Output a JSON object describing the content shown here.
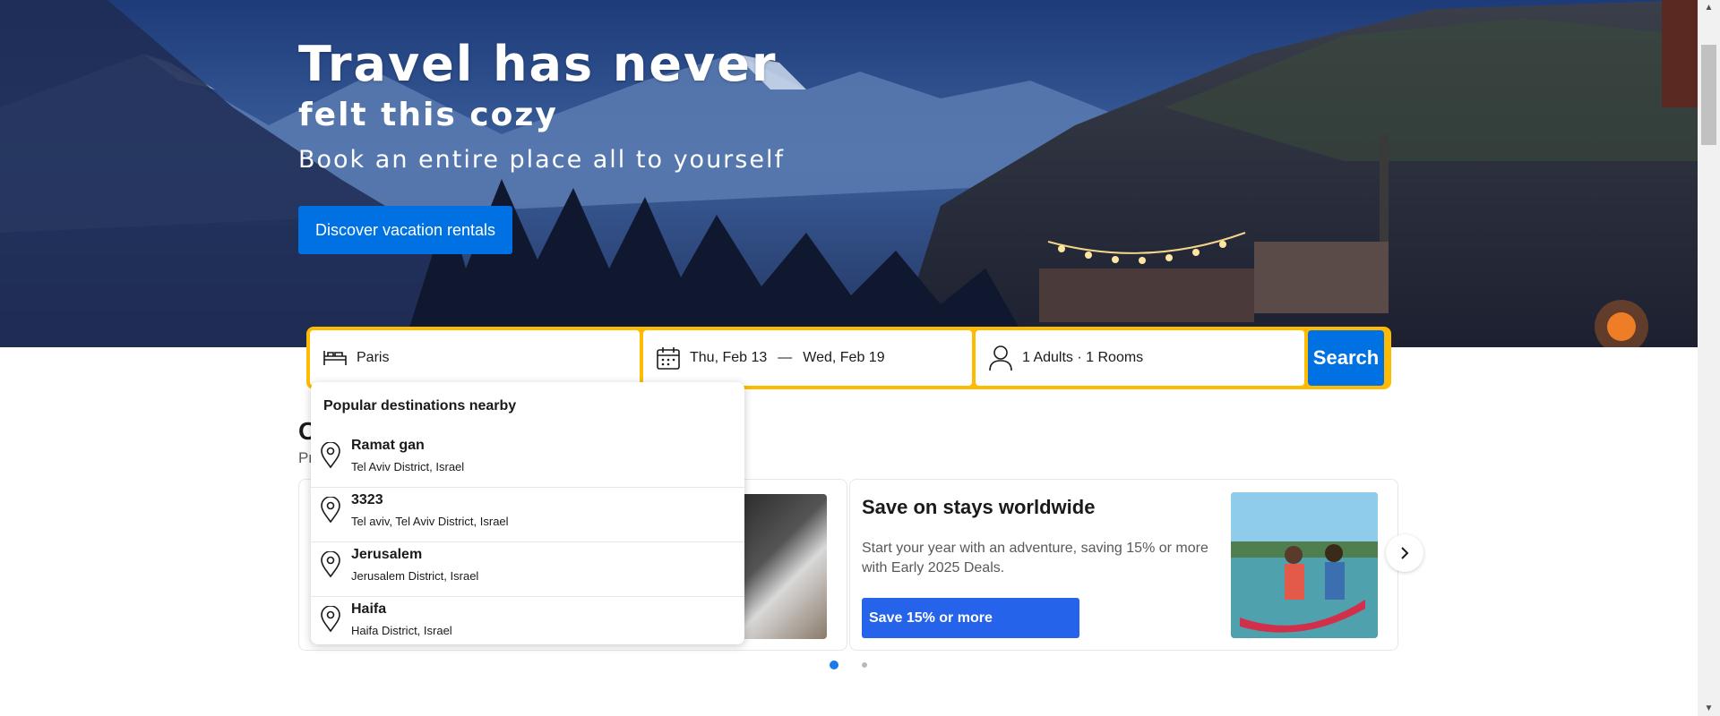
{
  "hero": {
    "title_line1": "Travel has never",
    "title_line2": "felt this cozy",
    "subtitle": "Book an entire place all to yourself",
    "cta_label": "Discover vacation rentals"
  },
  "search": {
    "destination_value": "Paris",
    "destination_icon": "bed-icon",
    "dates_icon": "calendar-icon",
    "check_in": "Thu, Feb 13",
    "date_separator": "—",
    "check_out": "Wed, Feb 19",
    "guests_icon": "person-icon",
    "guests": "1 Adults · 1 Rooms",
    "search_label": "Search"
  },
  "dropdown": {
    "heading": "Popular destinations nearby",
    "items": [
      {
        "name": "Ramat gan",
        "region": "Tel Aviv District, Israel"
      },
      {
        "name": "3323",
        "region": "Tel aviv, Tel Aviv District, Israel"
      },
      {
        "name": "Jerusalem",
        "region": "Jerusalem District, Israel"
      },
      {
        "name": "Haifa",
        "region": "Haifa District, Israel"
      }
    ]
  },
  "offers": {
    "heading_partial": "O",
    "sub_partial": "Pr",
    "card2": {
      "title": "Save on stays worldwide",
      "description": "Start your year with an adventure, saving 15% or more with Early 2025 Deals.",
      "button": "Save 15% or more"
    },
    "carousel_pages": 2,
    "carousel_active": 1
  },
  "colors": {
    "accent": "#0071e3",
    "searchbar_border": "#febb02",
    "card_button": "#2563eb"
  }
}
